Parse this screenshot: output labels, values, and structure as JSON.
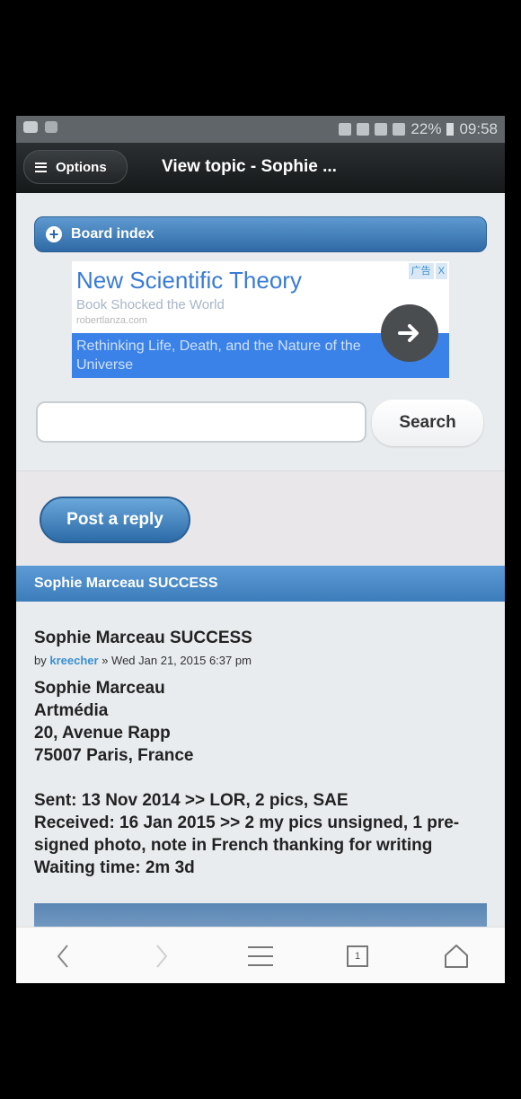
{
  "status_bar": {
    "battery": "22%",
    "time": "09:58"
  },
  "header": {
    "options_label": "Options",
    "title": "View topic - Sophie ..."
  },
  "board_index": {
    "label": "Board index"
  },
  "ad": {
    "title": "New Scientific Theory",
    "subtitle": "Book Shocked the World",
    "url": "robertlanza.com",
    "description": "Rethinking Life, Death, and the Nature of the Universe",
    "badge": "广告",
    "close": "X"
  },
  "search": {
    "placeholder": "",
    "button_label": "Search"
  },
  "post_reply_label": "Post a reply",
  "topic_bar": {
    "title": "Sophie Marceau SUCCESS"
  },
  "post": {
    "title": "Sophie Marceau SUCCESS",
    "by": "by",
    "author": "kreecher",
    "date": "» Wed Jan 21, 2015 6:37 pm",
    "address": [
      "Sophie Marceau",
      "Artmédia",
      "20, Avenue Rapp",
      "75007 Paris, France"
    ],
    "details": [
      "Sent: 13 Nov 2014 >> LOR, 2 pics, SAE",
      "Received: 16 Jan 2015 >> 2 my pics unsigned, 1 pre-signed photo, note in French thanking for writing",
      "Waiting time: 2m 3d"
    ]
  },
  "nav": {
    "tab_count": "1"
  },
  "colors": {
    "accent": "#3c7cba",
    "header_bg": "#1f2325",
    "link": "#3b8fcf"
  }
}
